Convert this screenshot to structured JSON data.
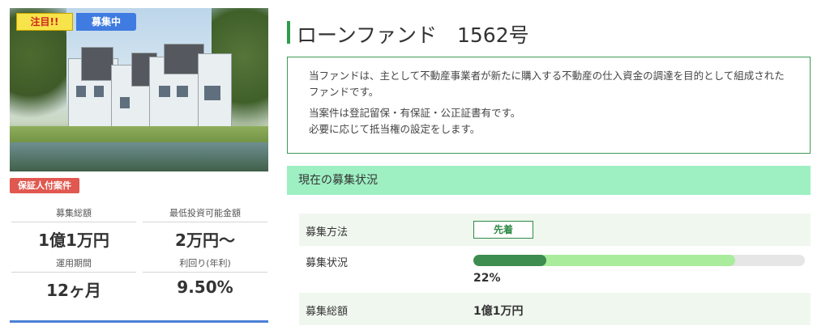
{
  "card": {
    "badge_attention": "注目!!",
    "badge_status": "募集中",
    "badge_guarantee": "保証人付案件",
    "image_alt": "modern townhouse complex illustration",
    "stats": [
      {
        "label": "募集総額",
        "value": "1億1万円"
      },
      {
        "label": "最低投資可能金額",
        "value": "2万円〜"
      },
      {
        "label": "運用期間",
        "value": "12ヶ月"
      },
      {
        "label": "利回り(年利)",
        "value": "9.50%"
      }
    ]
  },
  "fund": {
    "title": "ローンファンド　1562号",
    "description": [
      "当ファンドは、主として不動産事業者が新たに購入する不動産の仕入資金の調達を目的として組成されたファンドです。",
      "当案件は登記留保・有保証・公正証書有です。",
      "必要に応じて抵当権の設定をします。"
    ]
  },
  "status": {
    "heading": "現在の募集状況",
    "method_label": "募集方法",
    "method_value": "先着",
    "state_label": "募集状況",
    "progress_percent_text": "22%",
    "progress_actual": 0.22,
    "progress_secondary": 0.79,
    "total_label": "募集総額",
    "total_value": "1億1万円"
  },
  "colors": {
    "accent_green": "#2e9c4e",
    "status_head_bg": "#9ef0c3",
    "badge_blue": "#3f7be0",
    "badge_red": "#e0584f",
    "badge_yellow": "#f7e34a",
    "progress_dark": "#3d8c50",
    "progress_light": "#a9ec9c"
  }
}
